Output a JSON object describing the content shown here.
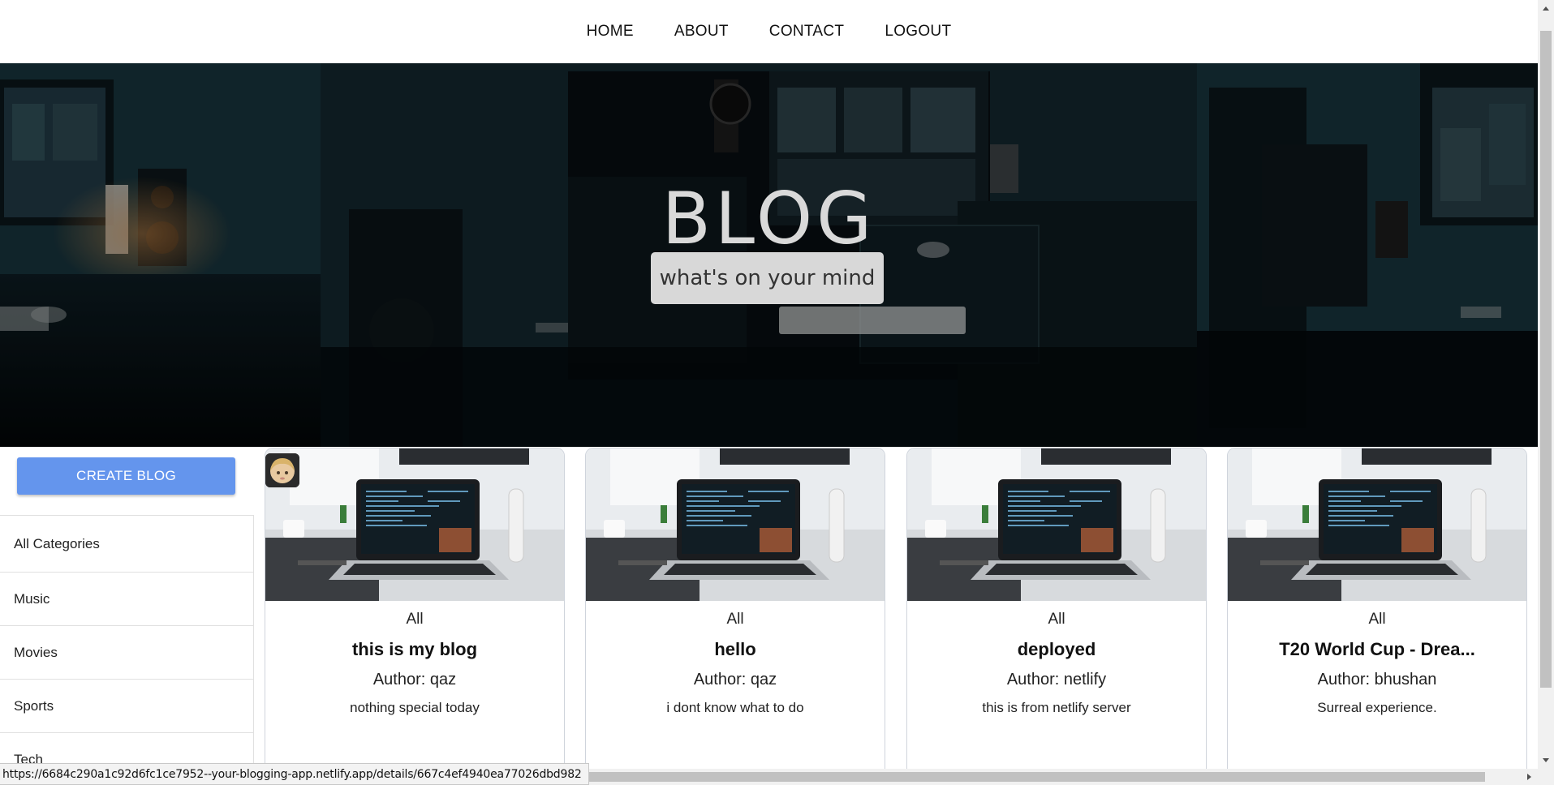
{
  "nav": {
    "items": [
      {
        "label": "HOME"
      },
      {
        "label": "ABOUT"
      },
      {
        "label": "CONTACT"
      },
      {
        "label": "LOGOUT"
      }
    ]
  },
  "hero": {
    "title": "BLOG",
    "subtitle": "what's on your mind"
  },
  "sidebar": {
    "create_button": "CREATE BLOG",
    "categories": [
      {
        "label": "All Categories"
      },
      {
        "label": "Music"
      },
      {
        "label": "Movies"
      },
      {
        "label": "Sports"
      },
      {
        "label": "Tech"
      }
    ]
  },
  "posts": [
    {
      "category": "All",
      "title": "this is my blog",
      "author": "Author: qaz",
      "description": "nothing special today"
    },
    {
      "category": "All",
      "title": "hello",
      "author": "Author: qaz",
      "description": "i dont know what to do"
    },
    {
      "category": "All",
      "title": "deployed",
      "author": "Author: netlify",
      "description": "this is from netlify server"
    },
    {
      "category": "All",
      "title": "T20 World Cup - Drea...",
      "author": "Author: bhushan",
      "description": "Surreal experience."
    }
  ],
  "status_bar": {
    "url": "https://6684c290a1c92d6fc1ce7952--your-blogging-app.netlify.app/details/667c4ef4940ea77026dbd982"
  },
  "colors": {
    "accent": "#6495ed",
    "hero_overlay": "#0b1a22"
  },
  "icons": {
    "avatar": "user-avatar-icon"
  }
}
